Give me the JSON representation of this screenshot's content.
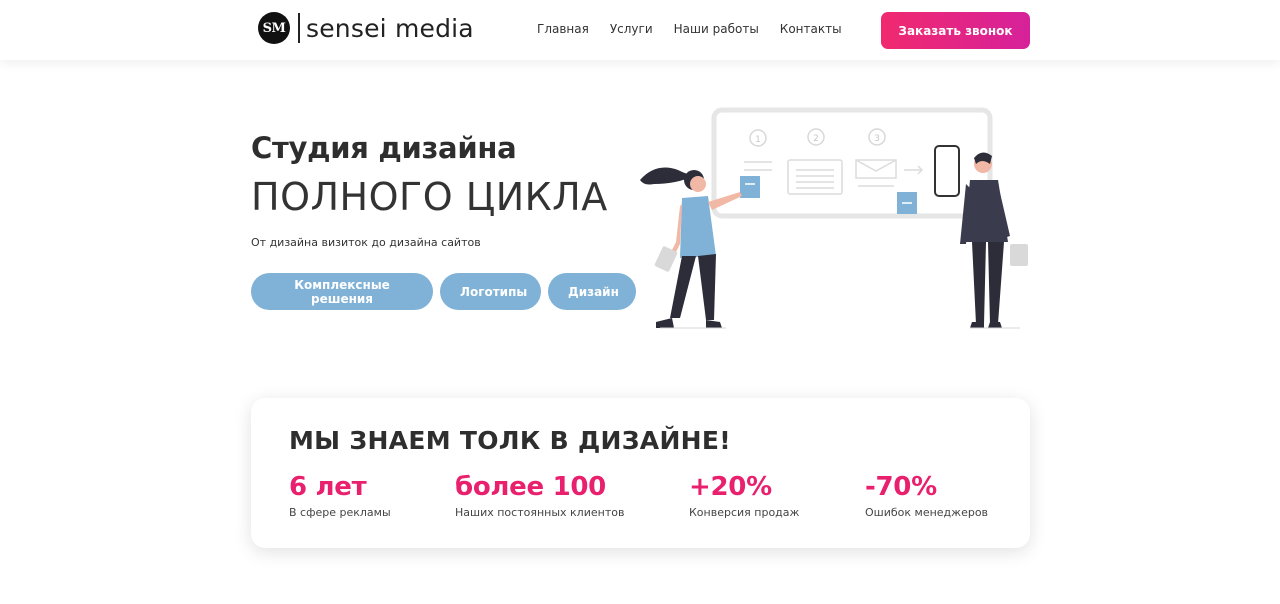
{
  "header": {
    "logo_mark": "SM",
    "logo_text": "sensei media",
    "nav": [
      "Главная",
      "Услуги",
      "Наши работы",
      "Контакты"
    ],
    "cta_label": "Заказать звонок"
  },
  "hero": {
    "title": "Студия дизайна",
    "subtitle": "ПОЛНОГО ЦИКЛА",
    "description": "От дизайна визиток до дизайна сайтов",
    "buttons": [
      "Комплексные решения",
      "Логотипы",
      "Дизайн"
    ]
  },
  "illustration": {
    "step_numbers": [
      "1",
      "2",
      "3"
    ]
  },
  "stats": {
    "title": "МЫ ЗНАЕМ ТОЛК В ДИЗАЙНЕ!",
    "items": [
      {
        "value": "6 лет",
        "label": "В сфере рекламы"
      },
      {
        "value": "более 100",
        "label": "Наших постоянных клиентов"
      },
      {
        "value": "+20%",
        "label": "Конверсия продаж"
      },
      {
        "value": "-70%",
        "label": "Ошибок менеджеров"
      }
    ]
  },
  "colors": {
    "accent": "#e8206d",
    "button_blue": "#7fb2d6",
    "cta_gradient_start": "#f0296f",
    "cta_gradient_end": "#d6219a"
  }
}
